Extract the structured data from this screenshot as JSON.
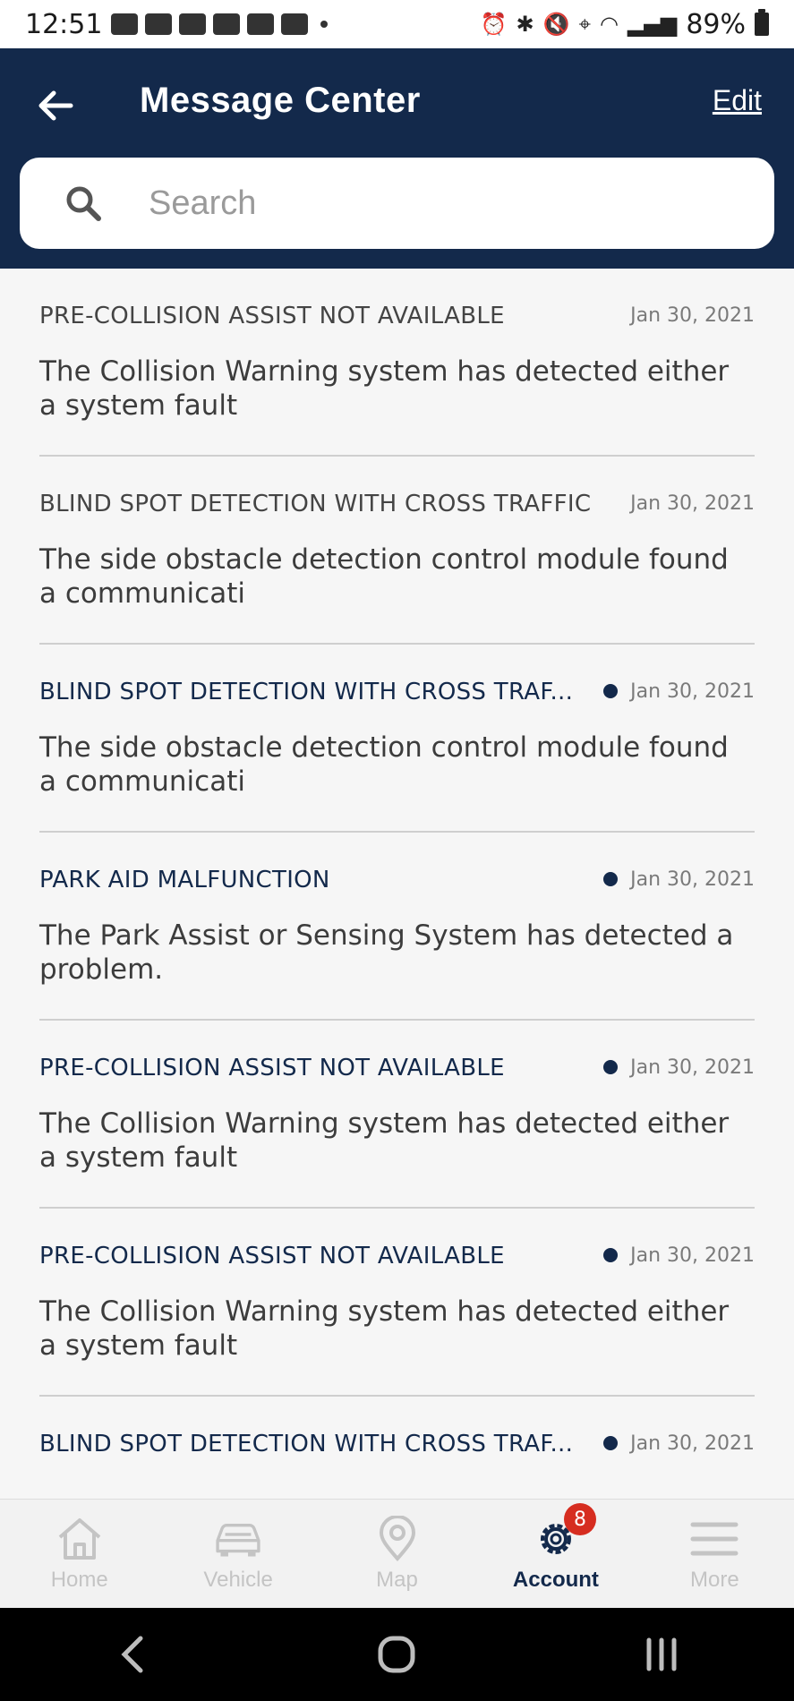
{
  "status_bar": {
    "time": "12:51",
    "battery": "89%"
  },
  "header": {
    "title": "Message Center",
    "edit_label": "Edit"
  },
  "search": {
    "placeholder": "Search",
    "value": ""
  },
  "messages": [
    {
      "title": "PRE-COLLISION ASSIST NOT AVAILABLE",
      "date": "Jan 30, 2021",
      "body": "The Collision Warning system has detected either a system fault",
      "unread": false
    },
    {
      "title": "BLIND SPOT DETECTION WITH CROSS TRAFFIC",
      "date": "Jan 30, 2021",
      "body": "The side obstacle detection control module found a communicati",
      "unread": false
    },
    {
      "title": "BLIND SPOT DETECTION WITH CROSS TRAF...",
      "date": "Jan 30, 2021",
      "body": "The side obstacle detection control module found a communicati",
      "unread": true
    },
    {
      "title": "PARK AID MALFUNCTION",
      "date": "Jan 30, 2021",
      "body": "The Park Assist or Sensing System has detected a problem.",
      "unread": true
    },
    {
      "title": "PRE-COLLISION ASSIST NOT AVAILABLE",
      "date": "Jan 30, 2021",
      "body": "The Collision Warning system has detected either a system fault",
      "unread": true
    },
    {
      "title": "PRE-COLLISION ASSIST NOT AVAILABLE",
      "date": "Jan 30, 2021",
      "body": "The Collision Warning system has detected either a system fault",
      "unread": true
    },
    {
      "title": "BLIND SPOT DETECTION WITH CROSS TRAF...",
      "date": "Jan 30, 2021",
      "body": "",
      "unread": true
    }
  ],
  "bottom_nav": {
    "home": "Home",
    "vehicle": "Vehicle",
    "map": "Map",
    "account": "Account",
    "account_badge": "8",
    "more": "More"
  },
  "colors": {
    "header_bg": "#13294b",
    "accent": "#13294b",
    "badge": "#d62d20"
  }
}
